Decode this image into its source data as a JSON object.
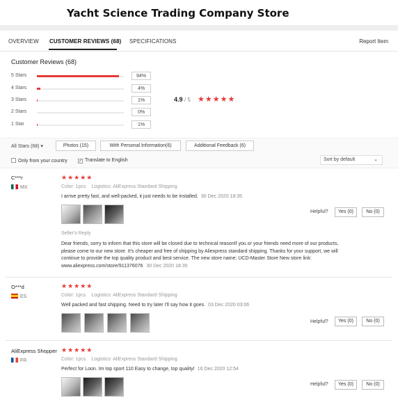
{
  "store": {
    "title": "Yacht Science Trading Company Store"
  },
  "tabs": [
    {
      "label": "OVERVIEW"
    },
    {
      "label": "CUSTOMER REVIEWS (68)"
    },
    {
      "label": "SPECIFICATIONS"
    }
  ],
  "report_link": "Report Item",
  "reviews_heading": "Customer Reviews (68)",
  "ratings": [
    {
      "label": "5 Stars",
      "pct": "94%",
      "fraction": 0.94
    },
    {
      "label": "4 Stars",
      "pct": "4%",
      "fraction": 0.04
    },
    {
      "label": "3 Stars",
      "pct": "1%",
      "fraction": 0.01
    },
    {
      "label": "2 Stars",
      "pct": "0%",
      "fraction": 0.0
    },
    {
      "label": "1 Star",
      "pct": "1%",
      "fraction": 0.01
    }
  ],
  "average": {
    "value": "4.9",
    "out_of": "/ 5",
    "stars": "★★★★★"
  },
  "filters": {
    "all_stars": "All Stars (68)",
    "buttons": [
      {
        "label": "Photos (15)"
      },
      {
        "label": "With Personal Information(6)"
      },
      {
        "label": "Additional Feedback (6)"
      }
    ],
    "only_country": "Only from your country",
    "translate": "Translate to English",
    "sort": "Sort by default"
  },
  "reviews": [
    {
      "name": "C***r",
      "country": "MX",
      "stars": "★★★★★",
      "color": "Color: 1pcs",
      "logistics": "Logistics: AliExpress Standard Shipping",
      "text": "I arrive pretty fast, and well-packed, it just needs to be installed.",
      "date": "30 Dec 2020 18:35",
      "helpful": "Helpful?",
      "yes": "Yes (0)",
      "no": "No (0)",
      "seller_label": "Seller's Reply",
      "seller_text": "Dear friends, sorry to inform that this store will be closed due to technical reasonIf you or your friends need more of our products, please come to our new store. It's cheaper and free of shipping by Aliexpress standard shipping. Thanks for your support, we will continue to provide the top quality product and best service. The new store name: UCD-Master Store New store link: www.aliexpress.com/store/911376076",
      "seller_date": "30 Dec 2020 18:35"
    },
    {
      "name": "O***d",
      "country": "ES",
      "stars": "★★★★★",
      "color": "Color: 1pcs",
      "logistics": "Logistics: AliExpress Standard Shipping",
      "text": "Well packed and fast shipping. Need to try later I'll say how it goes.",
      "date": "03 Dec 2020 03:06",
      "helpful": "Helpful?",
      "yes": "Yes (0)",
      "no": "No (0)"
    },
    {
      "name": "AliExpress Shopper",
      "country": "FR",
      "stars": "★★★★★",
      "color": "Color: 1pcs",
      "logistics": "Logistics: AliExpress Standard Shipping",
      "text": "Perfect for Loon. Im top sport 110 Easy to change, top quality!",
      "date": "16 Dec 2020 12:54",
      "helpful": "Helpful?",
      "yes": "Yes (0)",
      "no": "No (0)"
    }
  ],
  "colors": {
    "accent": "#e53935",
    "border": "#cccccc",
    "muted": "#999999"
  }
}
